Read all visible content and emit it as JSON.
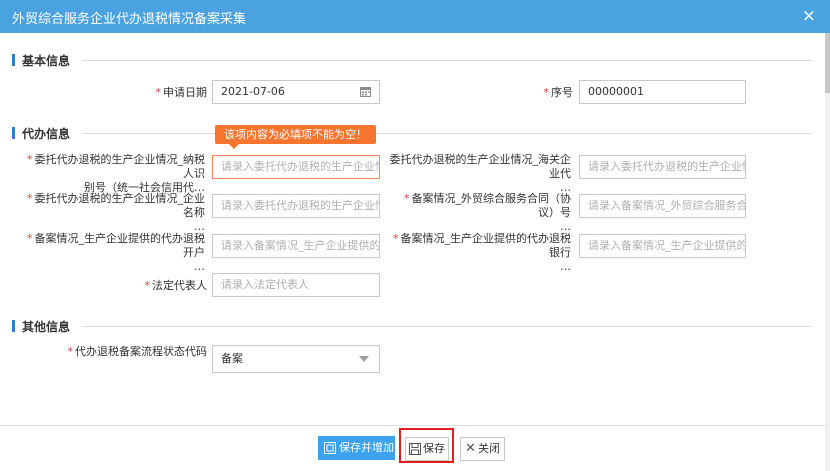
{
  "dialog": {
    "title": "外贸综合服务企业代办退税情况备案采集",
    "close_icon": "×"
  },
  "sections": {
    "basic": "基本信息",
    "agent": "代办信息",
    "other": "其他信息"
  },
  "fields": {
    "apply_date": {
      "required": "*",
      "label": "申请日期",
      "value": "2021-07-06",
      "icon": "calendar-icon"
    },
    "serial_no": {
      "required": "*",
      "label": "序号",
      "value": "00000001"
    },
    "taxpayer_id": {
      "required": "*",
      "label_line1": "委托代办退税的生产企业情况_纳税人识",
      "label_line2": "别号（统一社会信用代…",
      "placeholder": "请录入委托代办退税的生产企业情况"
    },
    "customs_code": {
      "required": "",
      "label_line1": "委托代办退税的生产企业情况_海关企业代",
      "label_line2": "…",
      "placeholder": "请录入委托代办退税的生产企业情况"
    },
    "company_name": {
      "required": "*",
      "label_line1": "委托代办退税的生产企业情况_企业名称",
      "label_line2": "…",
      "placeholder": "请录入委托代办退税的生产企业情况"
    },
    "contract_no": {
      "required": "*",
      "label_line1": "备案情况_外贸综合服务合同（协议）号",
      "label_line2": "…",
      "placeholder": "请录入备案情况_外贸综合服务合同"
    },
    "bank_name": {
      "required": "*",
      "label_line1": "备案情况_生产企业提供的代办退税开户",
      "label_line2": "…",
      "placeholder": "请录入备案情况_生产企业提供的代"
    },
    "bank_account": {
      "required": "*",
      "label_line1": "备案情况_生产企业提供的代办退税银行",
      "label_line2": "…",
      "placeholder": "请录入备案情况_生产企业提供的代"
    },
    "legal_rep": {
      "required": "*",
      "label": "法定代表人",
      "placeholder": "请录入法定代表人"
    },
    "status_code": {
      "required": "*",
      "label": "代办退税备案流程状态代码",
      "value": "备案"
    }
  },
  "validation": {
    "message": "该项内容为必填项不能为空！"
  },
  "buttons": {
    "save_add": "保存并增加",
    "save": "保存",
    "close": "关闭"
  },
  "colors": {
    "titlebar": "#4aa3e0",
    "accent": "#2f7fd6",
    "required": "#e53935",
    "tooltip": "#f8752f",
    "highlight": "#e02020"
  }
}
